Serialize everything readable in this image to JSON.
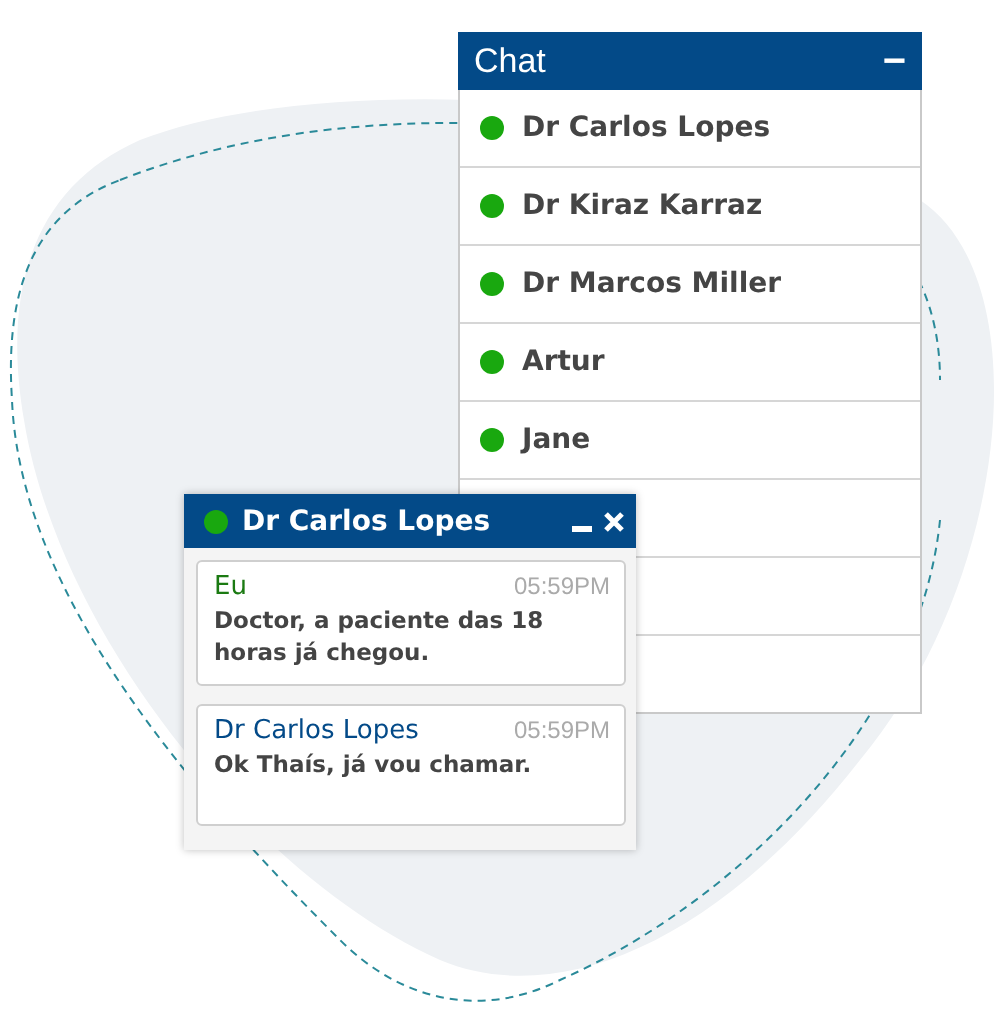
{
  "contacts_panel": {
    "title": "Chat",
    "minimize_icon": "−",
    "contacts": [
      {
        "name": "Dr Carlos Lopes",
        "online": true
      },
      {
        "name": "Dr Kiraz Karraz",
        "online": true
      },
      {
        "name": "Dr Marcos Miller",
        "online": true
      },
      {
        "name": "Artur",
        "online": true
      },
      {
        "name": "Jane",
        "online": true
      }
    ]
  },
  "chat_window": {
    "title": "Dr Carlos Lopes",
    "online": true,
    "messages": [
      {
        "kind": "own",
        "author": "Eu",
        "time": "05:59PM",
        "text": "Doctor, a paciente das 18 horas já chegou."
      },
      {
        "kind": "contact",
        "author": "Dr Carlos Lopes",
        "time": "05:59PM",
        "text": "Ok Thaís, já vou chamar."
      }
    ]
  }
}
